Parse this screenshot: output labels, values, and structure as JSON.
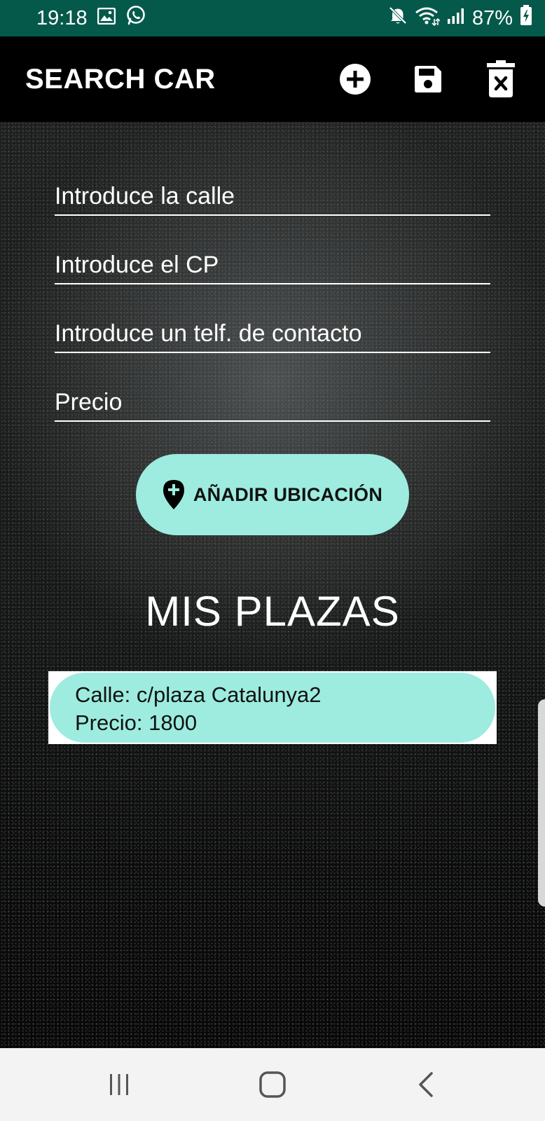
{
  "status_bar": {
    "time": "19:18",
    "battery": "87%",
    "icons": [
      "gallery-icon",
      "whatsapp-icon",
      "mute-icon",
      "wifi-icon",
      "signal-icon",
      "battery-charging-icon"
    ]
  },
  "app_bar": {
    "title": "SEARCH CAR",
    "actions": [
      "add-circle-icon",
      "save-icon",
      "delete-icon"
    ]
  },
  "form": {
    "street_placeholder": "Introduce la calle",
    "cp_placeholder": "Introduce el CP",
    "phone_placeholder": "Introduce un telf. de contacto",
    "price_placeholder": "Precio",
    "add_location_label": "AÑADIR UBICACIÓN",
    "add_location_icon": "add-location-icon"
  },
  "section_title": "MIS PLAZAS",
  "plazas": [
    {
      "street": "Calle: c/plaza Catalunya2",
      "price": "Precio: 1800"
    }
  ],
  "nav_bar": {
    "icons": [
      "recent-apps-icon",
      "home-icon",
      "back-icon"
    ]
  },
  "colors": {
    "status_bar": "#04594b",
    "app_bar": "#000000",
    "accent": "#9decdf",
    "nav_bar": "#f3f3f3"
  }
}
